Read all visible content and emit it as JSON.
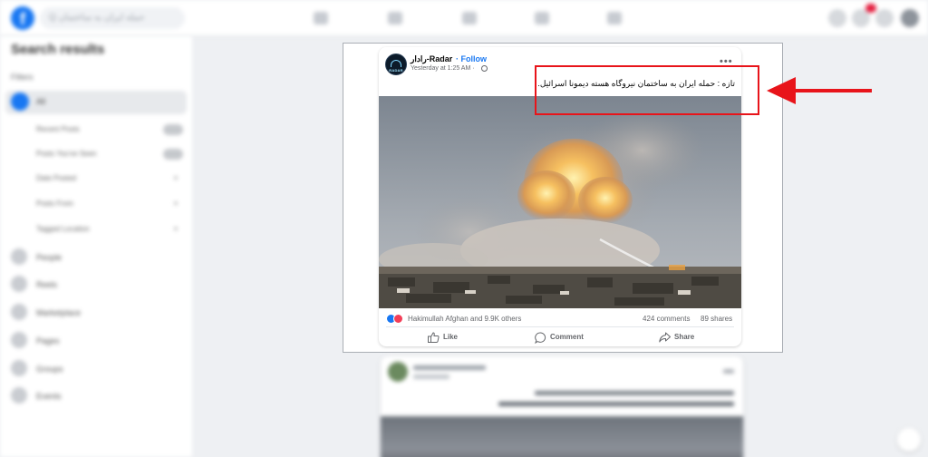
{
  "topbar": {
    "search_placeholder": "Q حمله ایران به ساختمان"
  },
  "sidebar": {
    "title": "Search results",
    "filters_label": "Filters",
    "all_label": "All",
    "options": [
      "Recent Posts",
      "Posts You've Seen",
      "Date Posted",
      "Posts From",
      "Tagged Location"
    ],
    "categories": [
      "People",
      "Reels",
      "Marketplace",
      "Pages",
      "Groups",
      "Events"
    ]
  },
  "post": {
    "page_name": "رادار-Radar",
    "follow_label": "· Follow",
    "timestamp": "Yesterday at 1:25 AM ·",
    "avatar_text": "RADAR",
    "caption": "تازه : حمله ایران به ساختمان نیروگاه هسته دیمونا  اسرائیل.",
    "reactors": "Hakimullah Afghan and 9.9K others",
    "comments_count": "424 comments",
    "shares_count": "89 shares",
    "actions": {
      "like": "Like",
      "comment": "Comment",
      "share": "Share"
    }
  },
  "annotation": {
    "highlight_color": "#e8141a"
  }
}
